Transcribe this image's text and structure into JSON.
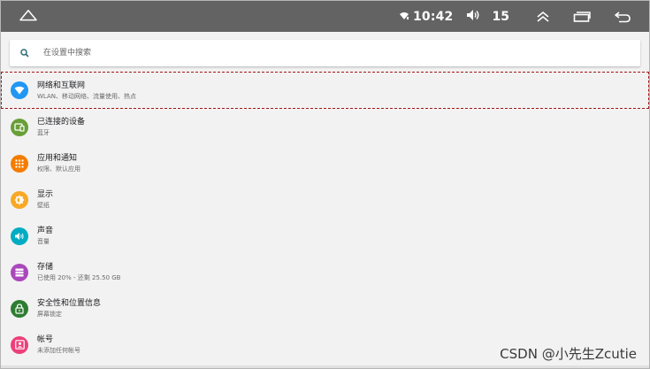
{
  "status_bar": {
    "time": "10:42",
    "volume": "15",
    "icons": [
      "home-icon",
      "wifi-icon",
      "volume-icon",
      "expand-up-icon",
      "recent-apps-icon",
      "back-icon"
    ]
  },
  "search": {
    "placeholder": "在设置中搜索",
    "icon": "search-icon"
  },
  "items": [
    {
      "title": "网络和互联网",
      "subtitle": "WLAN、移动网络、流量使用、热点",
      "icon": "network-icon",
      "color": "#2196F3",
      "selected": true
    },
    {
      "title": "已连接的设备",
      "subtitle": "蓝牙",
      "icon": "connected-devices-icon",
      "color": "#689F38"
    },
    {
      "title": "应用和通知",
      "subtitle": "权限、默认应用",
      "icon": "apps-icon",
      "color": "#F57C00"
    },
    {
      "title": "显示",
      "subtitle": "壁纸",
      "icon": "display-icon",
      "color": "#F9A825"
    },
    {
      "title": "声音",
      "subtitle": "音量",
      "icon": "sound-icon",
      "color": "#00ACC1"
    },
    {
      "title": "存储",
      "subtitle": "已使用 20% - 还剩 25.50 GB",
      "icon": "storage-icon",
      "color": "#AB47BC"
    },
    {
      "title": "安全性和位置信息",
      "subtitle": "屏幕锁定",
      "icon": "security-icon",
      "color": "#2E7D32"
    },
    {
      "title": "帐号",
      "subtitle": "未添加任何帐号",
      "icon": "account-icon",
      "color": "#EC407A"
    }
  ],
  "watermark": "CSDN @小先生Zcutie"
}
